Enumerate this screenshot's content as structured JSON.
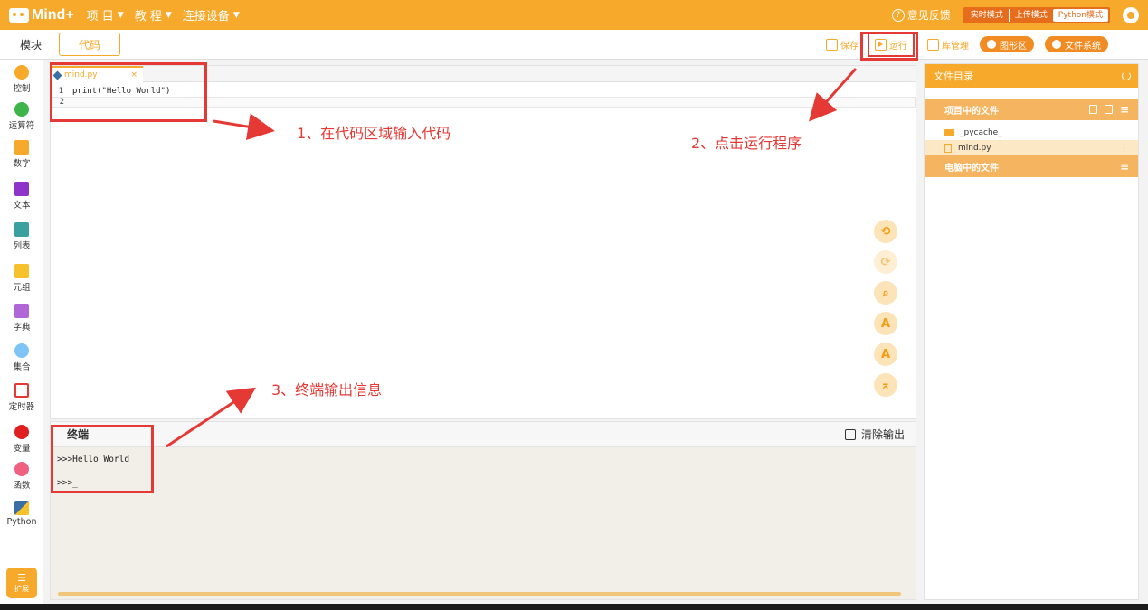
{
  "app": {
    "logo_text": "Mind+",
    "menus": [
      {
        "label": "项 目"
      },
      {
        "label": "教 程"
      },
      {
        "label": "连接设备"
      }
    ],
    "feedback_label": "意见反馈",
    "modes": [
      "实时模式",
      "上传模式",
      "Python模式"
    ]
  },
  "tabs": {
    "blocks": "模块",
    "code": "代码"
  },
  "toolbar": {
    "save": "保存",
    "run": "运行",
    "library": "库管理",
    "graphics": "图形区",
    "filesystem": "文件系统"
  },
  "sidebar": {
    "categories": [
      {
        "label": "控制",
        "color": "#f7a92b",
        "shape": "circle"
      },
      {
        "label": "运算符",
        "color": "#3db54a",
        "shape": "circle"
      },
      {
        "label": "数字",
        "color": "#f7a92b",
        "shape": "square"
      },
      {
        "label": "文本",
        "color": "#8e35c9",
        "shape": "square"
      },
      {
        "label": "列表",
        "color": "#3aa0a0",
        "shape": "square"
      },
      {
        "label": "元组",
        "color": "#f7c12b",
        "shape": "square"
      },
      {
        "label": "字典",
        "color": "#b065d8",
        "shape": "square"
      },
      {
        "label": "集合",
        "color": "#7ec5f5",
        "shape": "circle"
      },
      {
        "label": "定时器",
        "color": "#e53935",
        "shape": "hourglass"
      },
      {
        "label": "变量",
        "color": "#e02020",
        "shape": "circle"
      },
      {
        "label": "函数",
        "color": "#f06080",
        "shape": "circle"
      },
      {
        "label": "Python",
        "color": "#3a6ea5",
        "shape": "square"
      }
    ],
    "extension_label": "扩展"
  },
  "editor": {
    "file_tab": "mind.py",
    "close": "×",
    "lines": [
      {
        "num": "1",
        "code": "print(\"Hello World\")"
      },
      {
        "num": "2",
        "code": ""
      }
    ]
  },
  "terminal": {
    "title": "终端",
    "clear_label": "清除输出",
    "lines": [
      ">>>Hello World",
      ">>>_"
    ]
  },
  "files": {
    "title": "文件目录",
    "project_section": "项目中的文件",
    "computer_section": "电脑中的文件",
    "items": [
      {
        "name": "_pycache_",
        "type": "folder"
      },
      {
        "name": "mind.py",
        "type": "file"
      }
    ]
  },
  "annotations": {
    "step1": "1、在代码区域输入代码",
    "step2": "2、点击运行程序",
    "step3": "3、终端输出信息"
  }
}
